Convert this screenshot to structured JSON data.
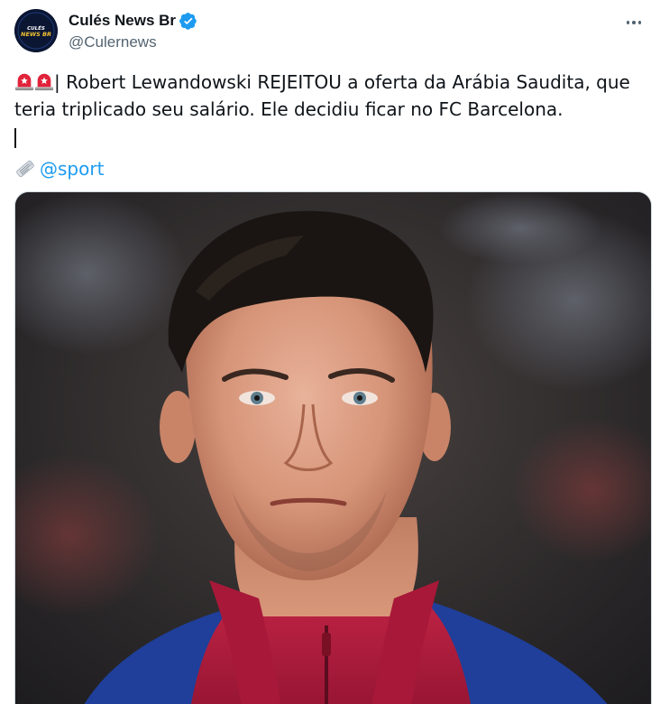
{
  "account": {
    "display_name": "Culés News Br",
    "handle": "@Culernews",
    "avatar_text_top": "CULÉS",
    "avatar_text_bottom": "NEWS BR",
    "verified_color": "#1d9bf0"
  },
  "tweet": {
    "text": "| Robert Lewandowski REJEITOU a oferta da Arábia Saudita, que teria triplicado seu salário. Ele decidiu ficar no FC Barcelona.",
    "source_mention": "@sport",
    "leading_icons": [
      "siren-emoji",
      "siren-emoji"
    ],
    "source_icon": "newspaper-emoji"
  },
  "media": {
    "description_icon": "player-photo"
  },
  "colors": {
    "link": "#1d9bf0",
    "secondary_text": "#536471",
    "primary_text": "#0f1419"
  }
}
